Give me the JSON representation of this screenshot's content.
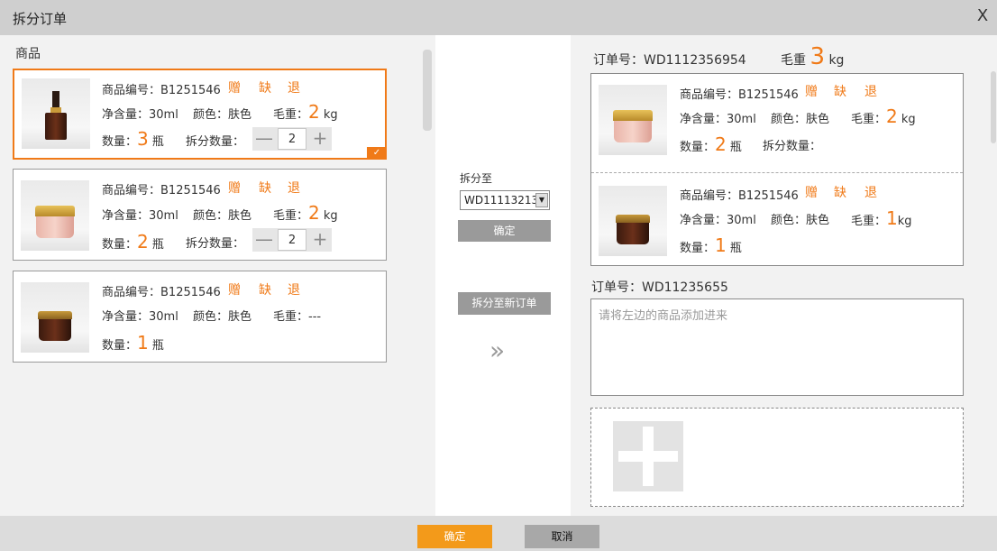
{
  "dialog": {
    "title": "拆分订单",
    "close": "X"
  },
  "left": {
    "heading": "商品",
    "items": [
      {
        "code_label": "商品编号：B1251546",
        "gift": "赠",
        "short": "缺",
        "return": "退",
        "volume": "净含量：30ml",
        "color": "颜色：肤色",
        "weight_label": "毛重：",
        "weight_value": "2",
        "weight_unit": "kg",
        "qty_label": "数量：",
        "qty_value": "3",
        "qty_unit": "瓶",
        "split_label": "拆分数量：",
        "split_value": "2",
        "minus": "—",
        "plus": "+",
        "check": "✓"
      },
      {
        "code_label": "商品编号：B1251546",
        "gift": "赠",
        "short": "缺",
        "return": "退",
        "volume": "净含量：30ml",
        "color": "颜色：肤色",
        "weight_label": "毛重：",
        "weight_value": "2",
        "weight_unit": "kg",
        "qty_label": "数量：",
        "qty_value": "2",
        "qty_unit": "瓶",
        "split_label": "拆分数量：",
        "split_value": "2",
        "minus": "—",
        "plus": "+"
      },
      {
        "code_label": "商品编号：B1251546",
        "gift": "赠",
        "short": "缺",
        "return": "退",
        "volume": "净含量：30ml",
        "color": "颜色：肤色",
        "weight_text": "毛重：---",
        "qty_label": "数量：",
        "qty_value": "1",
        "qty_unit": "瓶"
      }
    ]
  },
  "middle": {
    "split_to_label": "拆分至",
    "select_value": "WD11113213",
    "select_arrow": "▼",
    "confirm": "确定",
    "new_order": "拆分至新订单",
    "arrows": "»"
  },
  "right": {
    "order1": {
      "label": "订单号：WD1112356954",
      "gross_label": "毛重",
      "gross_value": "3",
      "gross_unit": "kg",
      "items": [
        {
          "code_label": "商品编号：B1251546",
          "gift": "赠",
          "short": "缺",
          "return": "退",
          "volume": "净含量：30ml",
          "color": "颜色：肤色",
          "weight_label": "毛重：",
          "weight_value": "2",
          "weight_unit": "kg",
          "qty_label": "数量：",
          "qty_value": "2",
          "qty_unit": "瓶",
          "split_label": "拆分数量："
        },
        {
          "code_label": "商品编号：B1251546",
          "gift": "赠",
          "short": "缺",
          "return": "退",
          "volume": "净含量：30ml",
          "color": "颜色：肤色",
          "weight_label": "毛重：",
          "weight_value": "1",
          "weight_unit": "kg",
          "qty_label": "数量：",
          "qty_value": "1",
          "qty_unit": "瓶"
        }
      ]
    },
    "order2": {
      "label": "订单号：WD11235655",
      "placeholder": "请将左边的商品添加进来"
    }
  },
  "footer": {
    "confirm": "确定",
    "cancel": "取消"
  },
  "colors": {
    "accent": "#f07a18",
    "confirm_button": "#f39a1a",
    "gray_button": "#9a9a9a"
  },
  "icons": {
    "close": "close-icon",
    "check": "check-icon",
    "minus": "minus-icon",
    "plus": "plus-icon",
    "dropdown": "dropdown-arrow-icon",
    "forward": "double-chevron-right-icon",
    "add": "add-plus-icon"
  }
}
